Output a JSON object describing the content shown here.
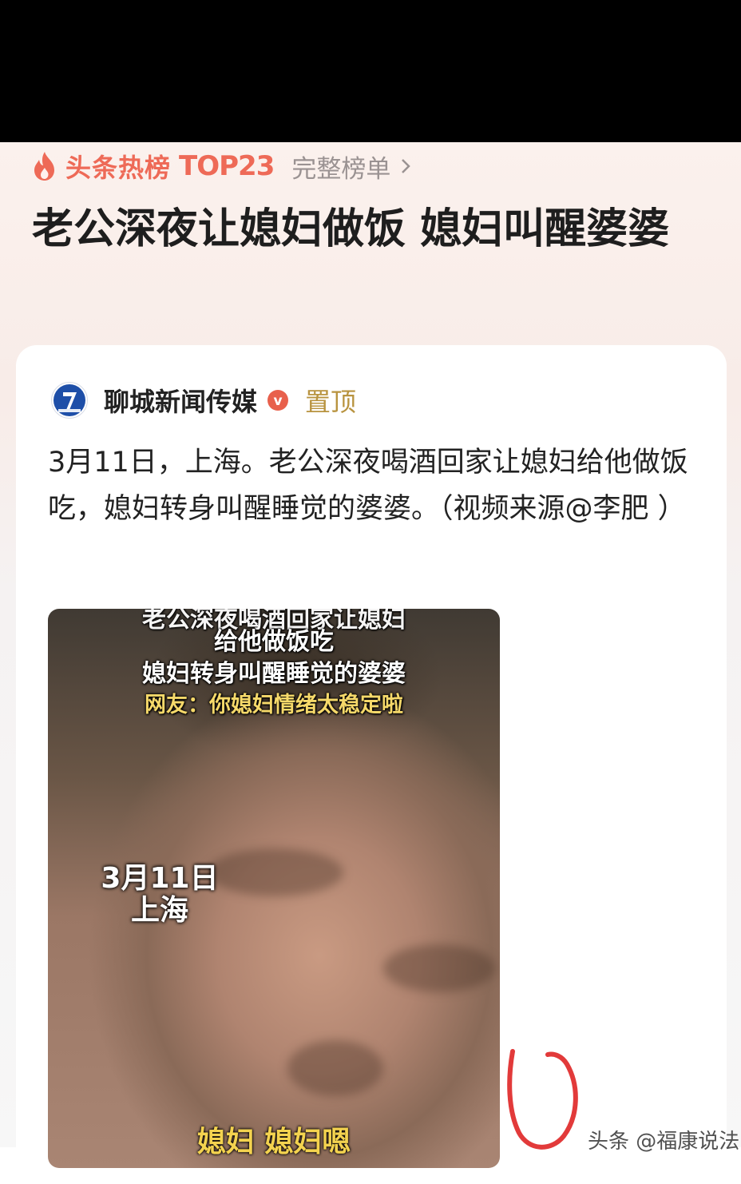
{
  "header": {
    "hot_label": "头条热榜",
    "hot_rank": "TOP23",
    "full_list_link": "完整榜单",
    "accent_color": "#ee6a57"
  },
  "headline": "老公深夜让媳妇做饭 媳妇叫醒婆婆",
  "post": {
    "author": "聊城新闻传媒",
    "verified_mark": "v",
    "pinned_badge": "置顶",
    "text": "3月11日，上海。老公深夜喝酒回家让媳妇给他做饭吃，媳妇转身叫醒睡觉的婆婆。（视频来源@李肥 ）"
  },
  "video": {
    "caption_line_1": "老公深夜喝酒回家让媳妇",
    "caption_line_2": "给他做饭吃",
    "caption_line_3": "媳妇转身叫醒睡觉的婆婆",
    "caption_line_4": "网友：你媳妇情绪太稳定啦",
    "date_line": "3月11日",
    "place_line": "上海",
    "subtitle": "媳妇 媳妇嗯"
  },
  "watermark": "头条 @福康说法"
}
